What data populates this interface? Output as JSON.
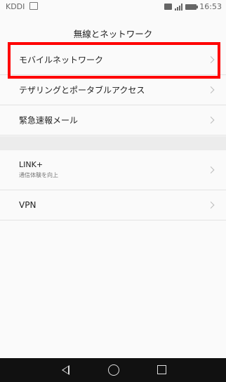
{
  "status_bar": {
    "carrier": "KDDI",
    "time": "16:53"
  },
  "header": {
    "title": "無線とネットワーク"
  },
  "settings": {
    "items": [
      {
        "label": "モバイルネットワーク"
      },
      {
        "label": "テザリングとポータブルアクセス"
      },
      {
        "label": "緊急速報メール"
      },
      {
        "label": "LINK+",
        "subtitle": "通信体験を向上"
      },
      {
        "label": "VPN"
      }
    ]
  },
  "colors": {
    "highlight": "#ff0000",
    "background": "#fafafa",
    "nav_bar": "#111111"
  },
  "icons": [
    "sim-icon",
    "hd-icon",
    "signal-icon",
    "battery-icon",
    "chevron-right-icon",
    "back-icon",
    "home-icon",
    "recents-icon"
  ]
}
